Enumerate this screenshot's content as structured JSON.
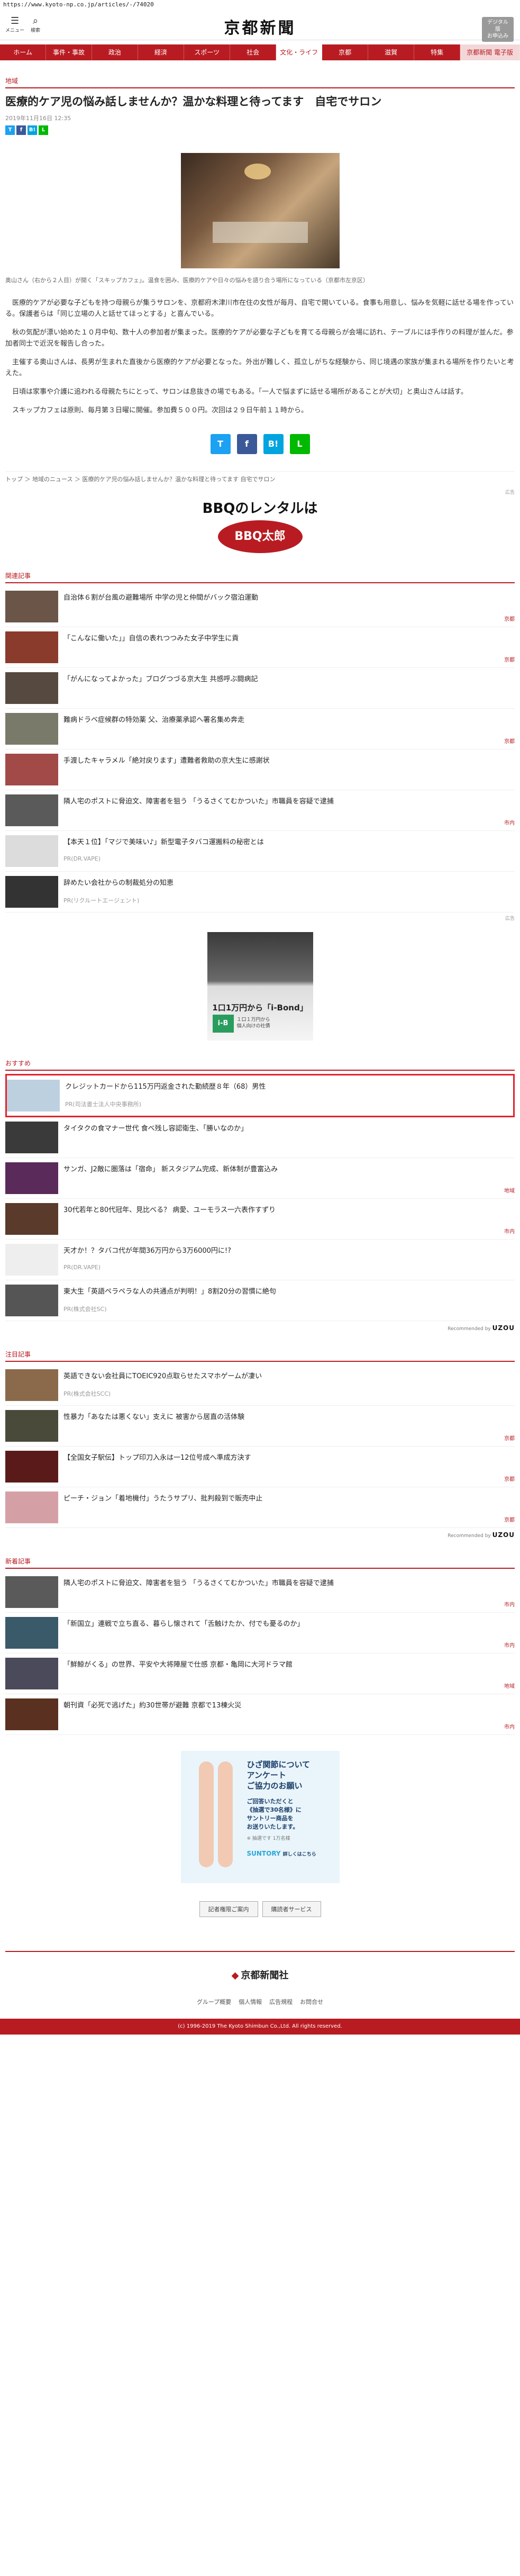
{
  "url": "https://www.kyoto-np.co.jp/articles/-/74020",
  "header": {
    "menu_label": "メニュー",
    "search_label": "検索",
    "logo": "京都新聞",
    "digital_label": "デジタル版\nお申込み"
  },
  "nav": [
    "ホーム",
    "事件・事故",
    "政治",
    "経済",
    "スポーツ",
    "社会",
    "文化・ライフ",
    "京都",
    "滋賀",
    "特集",
    "京都新聞 電子版"
  ],
  "article": {
    "category": "地域",
    "title": "医療的ケア児の悩み話しませんか？温かな料理と待ってます　自宅でサロン",
    "date": "2019年11月16日 12:35",
    "caption": "奥山さん（右から２人目）が開く「スキップカフェ」。温食を囲み、医療的ケアや日々の悩みを語り合う場所になっている（京都市左京区）",
    "paragraphs": [
      "医療的ケアが必要な子どもを持つ母親らが集うサロンを、京都府木津川市在住の女性が毎月、自宅で開いている。食事も用意し、悩みを気軽に話せる場を作っている。保護者らは「同じ立場の人と話せてほっとする」と喜んでいる。",
      "秋の気配が漂い始めた１０月中旬、数十人の参加者が集まった。医療的ケアが必要な子どもを育てる母親らが会場に訪れ、テーブルには手作りの料理が並んだ。参加者同士で近況を報告し合った。",
      "主催する奥山さんは、長男が生まれた直後から医療的ケアが必要となった。外出が難しく、孤立しがちな経験から、同じ境遇の家族が集まれる場所を作りたいと考えた。",
      "日頃は家事や介護に追われる母親たちにとって、サロンは息抜きの場でもある。「一人で悩まずに話せる場所があることが大切」と奥山さんは話す。",
      "スキップカフェは原則、毎月第３日曜に開催。参加費５００円。次回は２９日午前１１時から。"
    ]
  },
  "share": {
    "twitter": "T",
    "facebook": "f",
    "hatena": "B!",
    "line": "L"
  },
  "breadcrumb": "トップ ＞ 地域のニュース ＞ 医療的ケア児の悩み話しませんか？温かな料理と待ってます 自宅でサロン",
  "ad1": {
    "label": "広告",
    "title": "BBQのレンタルは",
    "logo": "BBQ太郎"
  },
  "related": {
    "title": "関連記事",
    "items": [
      {
        "title": "自治体６割が台風の避難場所  中学の児と仲間がバック宿泊運動",
        "src": "京都",
        "color": "#6a5548"
      },
      {
        "title": "「こんなに働いた」」自信の表れつつみた女子中学生に貢",
        "src": "京都",
        "color": "#8a3b2c"
      },
      {
        "title": "「がんになってよかった」ブログつづる京大生  共感呼ぶ闘病記",
        "src": "",
        "color": "#564a40"
      },
      {
        "title": "難病ドラベ症候群の特効薬  父、治療薬承認へ署名集め奔走",
        "src": "京都",
        "color": "#7a7a6a"
      },
      {
        "title": "手渡したキャラメル「絶対戻ります」遭難者救助の京大生に感謝状",
        "src": "",
        "color": "#a14a48"
      },
      {
        "title": "隣人宅のポストに脅迫文、障害者を狙う  「うるさくてむかついた」市職員を容疑で逮捕",
        "src": "市内",
        "color": "#5a5a5a"
      },
      {
        "title": "【本天１位】「マジで美味い♪」新型電子タバコ運搬料の秘密とは",
        "src": "PR(DR.VAPE)",
        "color": "#dcdcdc",
        "pr": true
      },
      {
        "title": "辞めたい会社からの制裁処分の知恵",
        "src": "PR(リクルートエージェント)",
        "color": "#333",
        "pr": true
      }
    ]
  },
  "ad2": {
    "label": "広告",
    "title": "1口1万円から「i-Bond」",
    "badge": "i-B",
    "sub": "１口１万円から\n個人向けの社債"
  },
  "recommend": {
    "title": "おすすめ",
    "items": [
      {
        "title": "クレジットカードから115万円返金された勤続歴８年（68）男性",
        "src": "PR(司法書士法人中央事務所)",
        "color": "#bcd0e0",
        "pr": true,
        "hl": true
      },
      {
        "title": "タイタクの食マナー世代  食べ残し容認衛生、「勝いなのか」",
        "src": "",
        "color": "#3a3a3a"
      },
      {
        "title": "サンガ、J2敵に圏落は「宿命」  新スタジアム完成、新体制が豊富込み",
        "src": "地域",
        "color": "#5a2a5a"
      },
      {
        "title": "30代若年と80代冠年、見比べる？  病愛、ユーモラス一六表作すずり",
        "src": "市内",
        "color": "#5a3a2a"
      },
      {
        "title": "天才か！？タバコ代が年間36万円から3万6000円に!?",
        "src": "PR(DR.VAPE)",
        "color": "#eeeeee",
        "pr": true
      },
      {
        "title": "東大生「英語ペラペラな人の共通点が判明！」8割20分の習慣に絶句",
        "src": "PR(株式会社SC)",
        "color": "#555",
        "pr": true
      }
    ],
    "powered_prefix": "Recommended by",
    "powered_brand": "UZOU"
  },
  "notice": {
    "title": "注目記事",
    "items": [
      {
        "title": "英語できない会社員にTOEIC920点取らせたスマホゲームが凄い",
        "src": "PR(株式会社SCC)",
        "color": "#8a6a4a",
        "pr": true
      },
      {
        "title": "性暴力「あなたは悪くない」支えに  被害から居直の活体験",
        "src": "京都",
        "color": "#4a4a3a"
      },
      {
        "title": "【全国女子駅伝】トップ印刀入永は一12位号成へ準成方決す",
        "src": "京都",
        "color": "#5a1a1a"
      },
      {
        "title": "ピーチ・ジョン「着地機付」うたうサプリ、批判殺到で販売中止",
        "src": "京都",
        "color": "#d4a0a6"
      }
    ],
    "powered_prefix": "Recommended by",
    "powered_brand": "UZOU"
  },
  "latest": {
    "title": "新着記事",
    "items": [
      {
        "title": "隣人宅のポストに脅迫文、障害者を狙う  「うるさくてむかついた」市職員を容疑で逮捕",
        "src": "市内",
        "color": "#5a5a5a"
      },
      {
        "title": "「新国立」連戦で立ち直る、暮らし懐されて「舌触けたか、付でも憂るのか」",
        "src": "市内",
        "color": "#3a5a6a"
      },
      {
        "title": "「鮮鯨がくる」の世界、平安や大将陣屋で仕感  京都・亀岡に大河ドラマ館",
        "src": "地域",
        "color": "#4a4a5a"
      },
      {
        "title": "朝刊資「必死で逃げた」約30世帯が避難  京都で13棟火災",
        "src": "市内",
        "color": "#5a3020"
      }
    ]
  },
  "suntory": {
    "l1": "ひざ関節について",
    "l2": "アンケート",
    "l3": "ご協力のお願い",
    "m1": "ご回答いただくと",
    "m2": "《抽選で30名様》に",
    "m3": "サントリー商品を",
    "m4": "お送りいたします。",
    "xs": "※ 抽選です 1万名様",
    "brand": "SUNTORY",
    "more": "詳しくはこちら"
  },
  "buttons": [
    "記者権限ご案内",
    "購読者サービス"
  ],
  "footer": {
    "logo_mark": "◆",
    "logo": "京都新聞社",
    "links": [
      "グループ概要",
      "個人情報",
      "広告規程",
      "お問合せ"
    ],
    "copyright": "(c) 1996-2019 The Kyoto Shimbun Co.,Ltd. All rights reserved."
  }
}
